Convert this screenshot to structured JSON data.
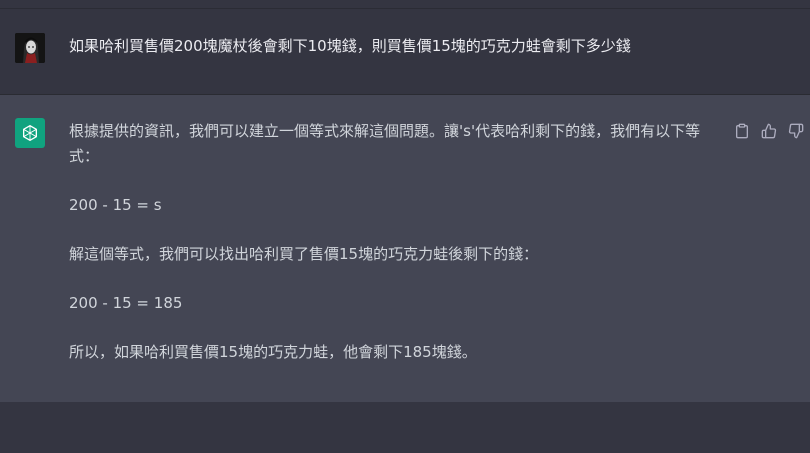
{
  "user_message": {
    "text": "如果哈利買售價200塊魔杖後會剩下10塊錢，則買售價15塊的巧克力蛙會剩下多少錢"
  },
  "assistant_message": {
    "paragraphs": [
      "根據提供的資訊，我們可以建立一個等式來解這個問題。讓's'代表哈利剩下的錢，我們有以下等式：",
      "200 - 15 = s",
      "解這個等式，我們可以找出哈利買了售價15塊的巧克力蛙後剩下的錢：",
      "200 - 15 = 185",
      "所以，如果哈利買售價15塊的巧克力蛙，他會剩下185塊錢。"
    ]
  },
  "icons": {
    "user_avatar": "user-avatar-image",
    "bot_avatar": "openai-logo-icon",
    "actions": [
      "clipboard-icon",
      "thumbs-up-icon",
      "thumbs-down-icon"
    ]
  },
  "colors": {
    "page_background": "#343541",
    "assistant_background": "#444654",
    "bot_avatar": "#10a37f"
  }
}
